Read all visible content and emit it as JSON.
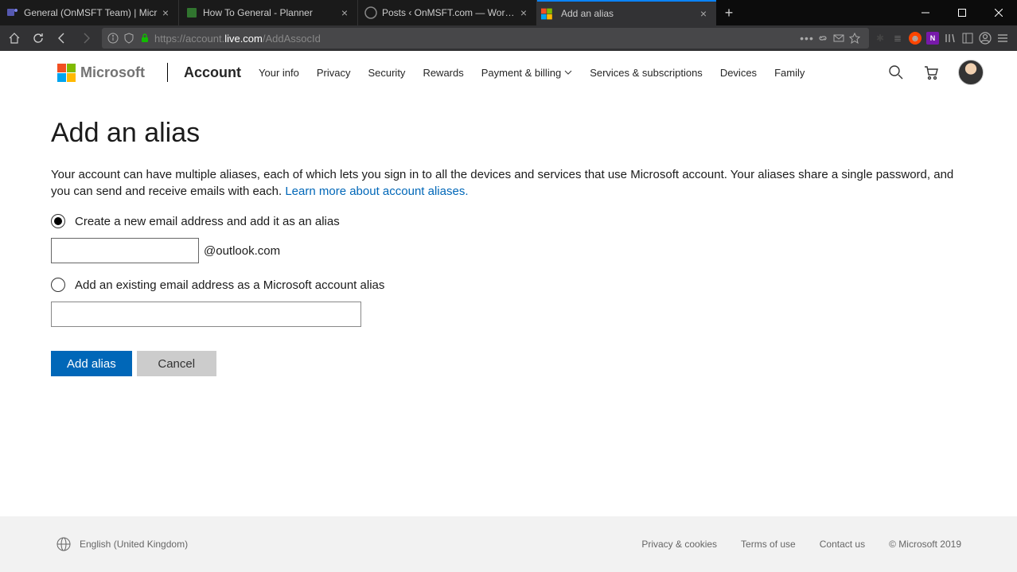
{
  "browser": {
    "tabs": [
      {
        "title": "General (OnMSFT Team) | Micr"
      },
      {
        "title": "How To General - Planner"
      },
      {
        "title": "Posts ‹ OnMSFT.com — WordPress"
      },
      {
        "title": "Add an alias"
      }
    ],
    "url": {
      "protocol": "https://",
      "sub": "account.",
      "host": "live.com",
      "path": "/AddAssocId"
    }
  },
  "header": {
    "brand": "Microsoft",
    "nav": {
      "account": "Account",
      "yourinfo": "Your info",
      "privacy": "Privacy",
      "security": "Security",
      "rewards": "Rewards",
      "payment": "Payment & billing",
      "services": "Services & subscriptions",
      "devices": "Devices",
      "family": "Family"
    }
  },
  "page": {
    "title": "Add an alias",
    "desc": "Your account can have multiple aliases, each of which lets you sign in to all the devices and services that use Microsoft account. Your aliases share a single password, and you can send and receive emails with each. ",
    "learn_link": "Learn more about account aliases.",
    "radio1": "Create a new email address and add it as an alias",
    "suffix": "@outlook.com",
    "radio2": "Add an existing email address as a Microsoft account alias",
    "add_btn": "Add alias",
    "cancel_btn": "Cancel"
  },
  "footer": {
    "lang": "English (United Kingdom)",
    "privacy": "Privacy & cookies",
    "terms": "Terms of use",
    "contact": "Contact us",
    "copyright": "© Microsoft 2019"
  }
}
